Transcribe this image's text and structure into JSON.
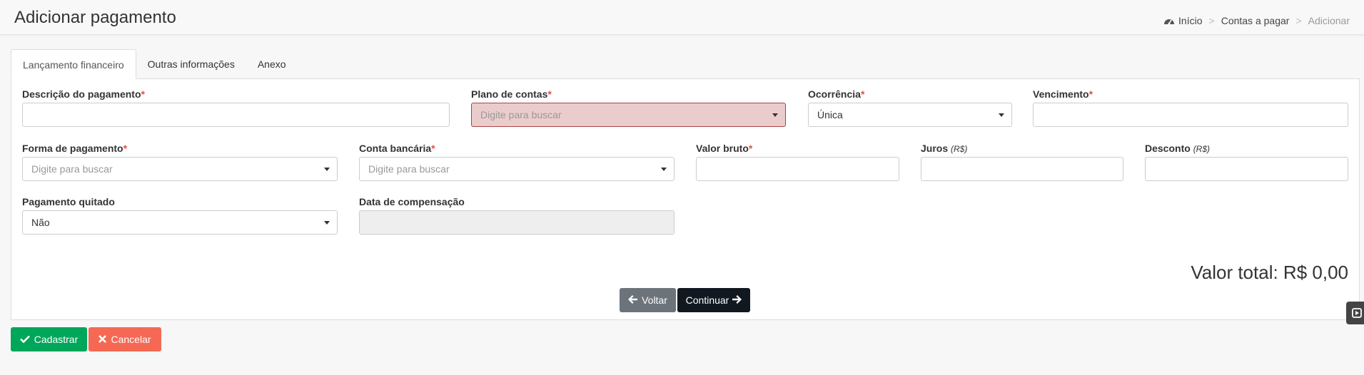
{
  "header": {
    "title": "Adicionar pagamento",
    "breadcrumb": [
      "Início",
      "Contas a pagar",
      "Adicionar"
    ],
    "separator": ">"
  },
  "tabs": [
    {
      "label": "Lançamento financeiro",
      "active": true
    },
    {
      "label": "Outras informações",
      "active": false
    },
    {
      "label": "Anexo",
      "active": false
    }
  ],
  "required_mark": "*",
  "form": {
    "descricao": {
      "label": "Descrição do pagamento",
      "value": ""
    },
    "plano": {
      "label": "Plano de contas",
      "placeholder": "Digite para buscar"
    },
    "ocorrencia": {
      "label": "Ocorrência",
      "value": "Única"
    },
    "vencimento": {
      "label": "Vencimento",
      "value": ""
    },
    "forma": {
      "label": "Forma de pagamento",
      "placeholder": "Digite para buscar"
    },
    "conta": {
      "label": "Conta bancária",
      "placeholder": "Digite para buscar"
    },
    "valor_bruto": {
      "label": "Valor bruto",
      "value": ""
    },
    "juros": {
      "label": "Juros",
      "unit": "(R$)",
      "value": ""
    },
    "desconto": {
      "label": "Desconto",
      "unit": "(R$)",
      "value": ""
    },
    "quitado": {
      "label": "Pagamento quitado",
      "value": "Não"
    },
    "compensacao": {
      "label": "Data de compensação",
      "value": ""
    }
  },
  "total": "Valor total: R$ 0,00",
  "buttons": {
    "back": "Voltar",
    "continue": "Continuar",
    "save": "Cadastrar",
    "cancel": "Cancelar"
  },
  "colors": {
    "save": "#00a65a",
    "cancel": "#f56954",
    "continue": "#111820",
    "back": "#6c737a",
    "error_bg": "#ebcccc"
  }
}
